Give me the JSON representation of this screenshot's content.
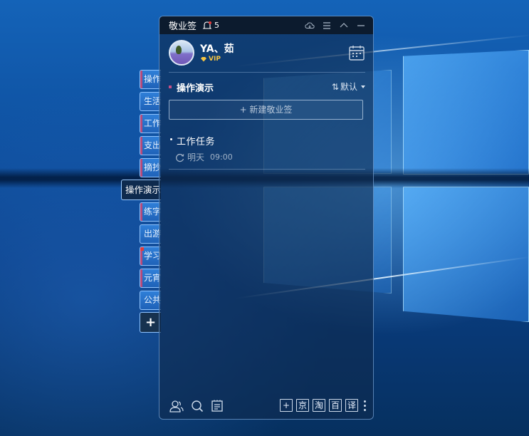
{
  "window": {
    "title": "敬业签",
    "notification_count": "5"
  },
  "user": {
    "name": "YA、茹",
    "badge": "VIP"
  },
  "category_tabs": [
    {
      "label": "操作",
      "marked": true
    },
    {
      "label": "生活",
      "marked": false
    },
    {
      "label": "工作",
      "marked": true
    },
    {
      "label": "支出",
      "marked": true
    },
    {
      "label": "摘抄",
      "marked": true
    },
    {
      "label": "操作演示",
      "active": true
    },
    {
      "label": "练字",
      "marked": true
    },
    {
      "label": "出游",
      "marked": false
    },
    {
      "label": "学习",
      "marked": true,
      "dot": true
    },
    {
      "label": "元宵",
      "marked": true
    },
    {
      "label": "公共",
      "marked": false
    }
  ],
  "add_tab_label": "+",
  "section": {
    "title": "操作演示",
    "sort_label": "默认",
    "sort_icon": "⇅"
  },
  "new_note_button": "+ 新建敬业签",
  "tasks": [
    {
      "title": "工作任务",
      "due_day": "明天",
      "due_time": "09:00"
    }
  ],
  "toolbar": {
    "buttons": [
      "+",
      "京",
      "淘",
      "百",
      "译"
    ]
  },
  "colors": {
    "accent_mark": "#c64f86",
    "vip_gold": "#f6c542",
    "notification_red": "#e23b3b"
  },
  "icons": [
    "bell-icon",
    "cloud-icon",
    "menu-icon",
    "collapse-icon",
    "minimize-icon",
    "calendar-icon",
    "contacts-icon",
    "search-icon",
    "notes-icon",
    "more-icon",
    "repeat-icon",
    "diamond-icon"
  ]
}
